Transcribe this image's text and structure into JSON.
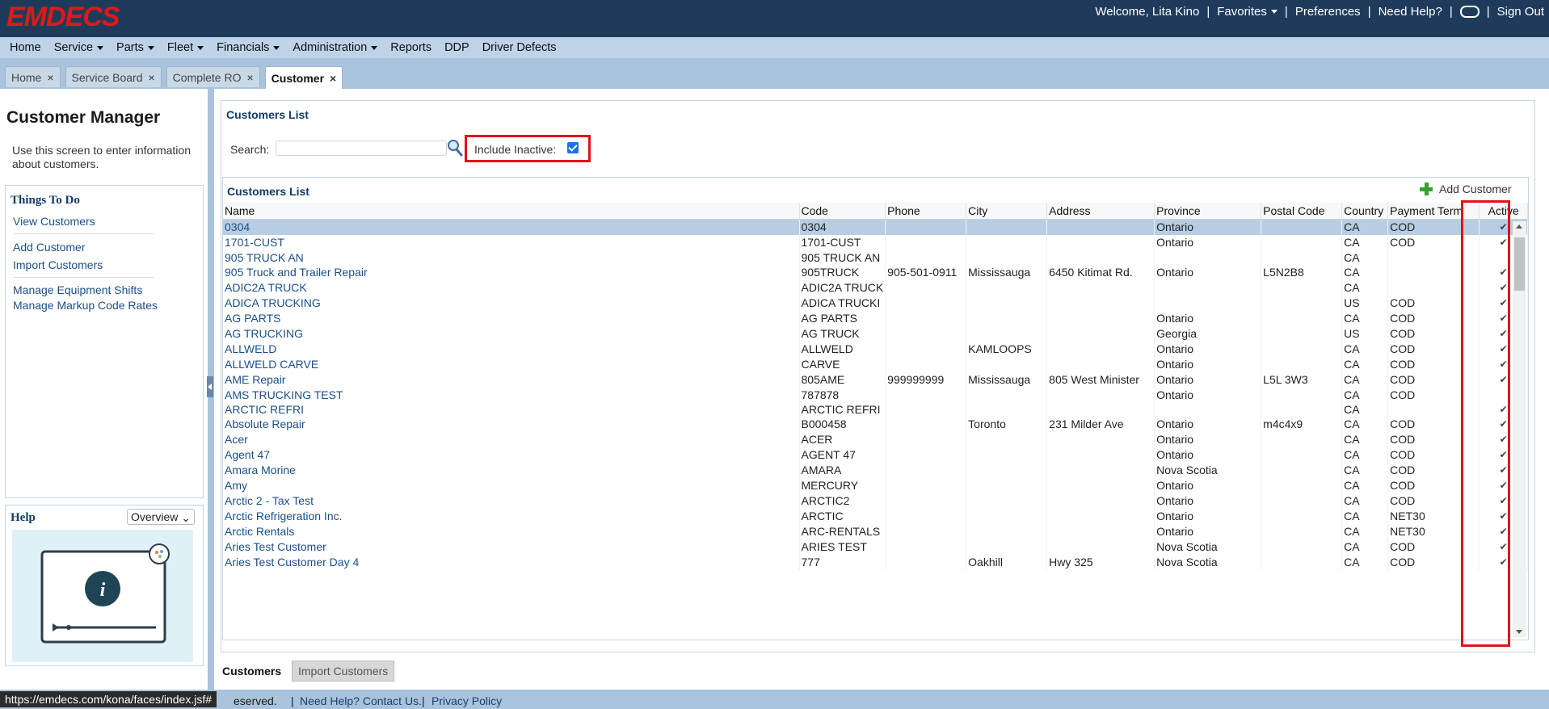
{
  "brand": {
    "logo": "EMDECS",
    "color": "#e01818"
  },
  "user_nav": {
    "welcome": "Welcome, Lita Kino",
    "favorites": "Favorites",
    "preferences": "Preferences",
    "help": "Need Help?",
    "signout": "Sign Out"
  },
  "menu": [
    "Home",
    "Service",
    "Parts",
    "Fleet",
    "Financials",
    "Administration",
    "Reports",
    "DDP",
    "Driver Defects"
  ],
  "tabs": [
    "Home",
    "Service Board",
    "Complete RO",
    "Customer"
  ],
  "left": {
    "title": "Customer Manager",
    "intro": "Use this screen to enter information about customers.",
    "things_title": "Things To Do",
    "links": [
      "View Customers",
      "Add Customer",
      "Import Customers",
      "Manage Equipment Shifts",
      "Manage Markup Code Rates"
    ],
    "help_title": "Help",
    "help_select": "Overview"
  },
  "main": {
    "section_title": "Customers List",
    "search_label": "Search:",
    "search_value": "",
    "include_inactive_label": "Include Inactive:",
    "include_inactive_checked": true,
    "list_title": "Customers List",
    "add_customer": "Add Customer"
  },
  "table": {
    "columns": [
      "Name",
      "Code",
      "Phone",
      "City",
      "Address",
      "Province",
      "Postal Code",
      "Country",
      "Payment Term",
      "Active"
    ],
    "rows": [
      [
        "0304",
        "0304",
        "",
        "",
        "",
        "Ontario",
        "",
        "CA",
        "COD",
        "✔"
      ],
      [
        "1701-CUST",
        "1701-CUST",
        "",
        "",
        "",
        "Ontario",
        "",
        "CA",
        "COD",
        "✔"
      ],
      [
        "905 TRUCK AN",
        "905 TRUCK AN",
        "",
        "",
        "",
        "",
        "",
        "CA",
        "",
        ""
      ],
      [
        "905 Truck and Trailer Repair",
        "905TRUCK",
        "905-501-0911",
        "Mississauga",
        "6450 Kitimat Rd.",
        "Ontario",
        "L5N2B8",
        "CA",
        "",
        "✔"
      ],
      [
        "ADIC2A TRUCK",
        "ADIC2A TRUCK",
        "",
        "",
        "",
        "",
        "",
        "CA",
        "",
        "✔"
      ],
      [
        "ADICA TRUCKING",
        "ADICA TRUCKI",
        "",
        "",
        "",
        "",
        "",
        "US",
        "COD",
        "✔"
      ],
      [
        "AG PARTS",
        "AG PARTS",
        "",
        "",
        "",
        "Ontario",
        "",
        "CA",
        "COD",
        "✔"
      ],
      [
        "AG TRUCKING",
        "AG TRUCK",
        "",
        "",
        "",
        "Georgia",
        "",
        "US",
        "COD",
        "✔"
      ],
      [
        "ALLWELD",
        "ALLWELD",
        "",
        "KAMLOOPS",
        "",
        "Ontario",
        "",
        "CA",
        "COD",
        "✔"
      ],
      [
        "ALLWELD CARVE",
        "CARVE",
        "",
        "",
        "",
        "Ontario",
        "",
        "CA",
        "COD",
        "✔"
      ],
      [
        "AME Repair",
        "805AME",
        "999999999",
        "Mississauga",
        "805 West Minister",
        "Ontario",
        "L5L 3W3",
        "CA",
        "COD",
        "✔"
      ],
      [
        "AMS TRUCKING TEST",
        "787878",
        "",
        "",
        "",
        "Ontario",
        "",
        "CA",
        "COD",
        ""
      ],
      [
        "ARCTIC REFRI",
        "ARCTIC REFRI",
        "",
        "",
        "",
        "",
        "",
        "CA",
        "",
        "✔"
      ],
      [
        "Absolute Repair",
        "B000458",
        "",
        "Toronto",
        "231 Milder Ave",
        "Ontario",
        "m4c4x9",
        "CA",
        "COD",
        "✔"
      ],
      [
        "Acer",
        "ACER",
        "",
        "",
        "",
        "Ontario",
        "",
        "CA",
        "COD",
        "✔"
      ],
      [
        "Agent 47",
        "AGENT 47",
        "",
        "",
        "",
        "Ontario",
        "",
        "CA",
        "COD",
        "✔"
      ],
      [
        "Amara Morine",
        "AMARA",
        "",
        "",
        "",
        "Nova Scotia",
        "",
        "CA",
        "COD",
        "✔"
      ],
      [
        "Amy",
        "MERCURY",
        "",
        "",
        "",
        "Ontario",
        "",
        "CA",
        "COD",
        "✔"
      ],
      [
        "Arctic 2 - Tax Test",
        "ARCTIC2",
        "",
        "",
        "",
        "Ontario",
        "",
        "CA",
        "COD",
        "✔"
      ],
      [
        "Arctic Refrigeration Inc.",
        "ARCTIC",
        "",
        "",
        "",
        "Ontario",
        "",
        "CA",
        "NET30",
        "✔"
      ],
      [
        "Arctic Rentals",
        "ARC-RENTALS",
        "",
        "",
        "",
        "Ontario",
        "",
        "CA",
        "NET30",
        "✔"
      ],
      [
        "Aries Test Customer",
        "ARIES TEST",
        "",
        "",
        "",
        "Nova Scotia",
        "",
        "CA",
        "COD",
        "✔"
      ],
      [
        "Aries Test Customer Day 4",
        "777",
        "",
        "Oakhill",
        "Hwy 325",
        "Nova Scotia",
        "",
        "CA",
        "COD",
        "✔"
      ]
    ]
  },
  "bottom_tabs": [
    "Customers",
    "Import Customers"
  ],
  "footer": {
    "status_url": "https://emdecs.com/kona/faces/index.jsf#",
    "reserved": "eserved.",
    "contact": "Need Help? Contact Us.",
    "privacy": "Privacy Policy"
  }
}
